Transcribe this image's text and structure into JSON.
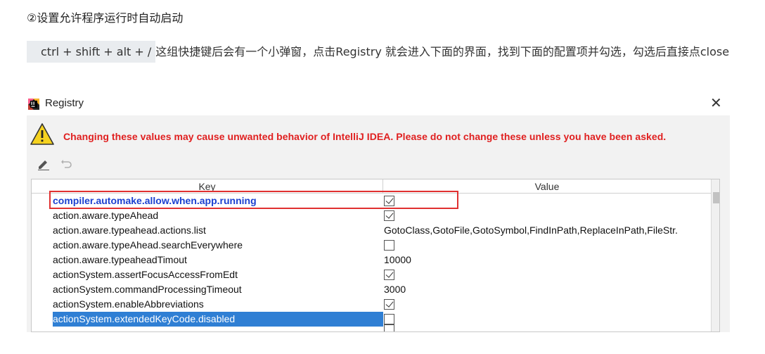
{
  "article": {
    "step_heading": "②设置允许程序运行时自动启动",
    "shortcut": "ctrl + shift + alt + /",
    "instruction": "这组快捷键后会有一个小弹窗，点击Registry 就会进入下面的界面，找到下面的配置项并勾选，勾选后直接点close"
  },
  "dialog": {
    "title": "Registry",
    "close_glyph": "✕",
    "app_icon": "intellij-idea-icon",
    "warning_icon": "warning-triangle-icon",
    "warning_text": "Changing these values may cause unwanted behavior of IntelliJ IDEA. Please do not change these unless you have been asked.",
    "warning_color": "#e02020",
    "toolbar": {
      "edit_icon": "pencil-icon",
      "undo_icon": "undo-icon"
    },
    "table": {
      "headers": {
        "key": "Key",
        "value": "Value"
      },
      "rows": [
        {
          "key": "compiler.automake.allow.when.app.running",
          "type": "checkbox",
          "checked": true,
          "modified": true
        },
        {
          "key": "action.aware.typeAhead",
          "type": "checkbox",
          "checked": true
        },
        {
          "key": "action.aware.typeahead.actions.list",
          "type": "text",
          "value": "GotoClass,GotoFile,GotoSymbol,FindInPath,ReplaceInPath,FileStr."
        },
        {
          "key": "action.aware.typeAhead.searchEverywhere",
          "type": "checkbox",
          "checked": false
        },
        {
          "key": "action.aware.typeaheadTimout",
          "type": "text",
          "value": "10000"
        },
        {
          "key": "actionSystem.assertFocusAccessFromEdt",
          "type": "checkbox",
          "checked": true
        },
        {
          "key": "actionSystem.commandProcessingTimeout",
          "type": "text",
          "value": "3000"
        },
        {
          "key": "actionSystem.enableAbbreviations",
          "type": "checkbox",
          "checked": true
        },
        {
          "key": "actionSystem.extendedKeyCode.disabled",
          "type": "checkbox",
          "checked": false,
          "selected": true
        }
      ],
      "modified_key_color": "#1a3fd0",
      "selection_color": "#2f7fd4"
    },
    "annotation_color": "#e03030"
  }
}
